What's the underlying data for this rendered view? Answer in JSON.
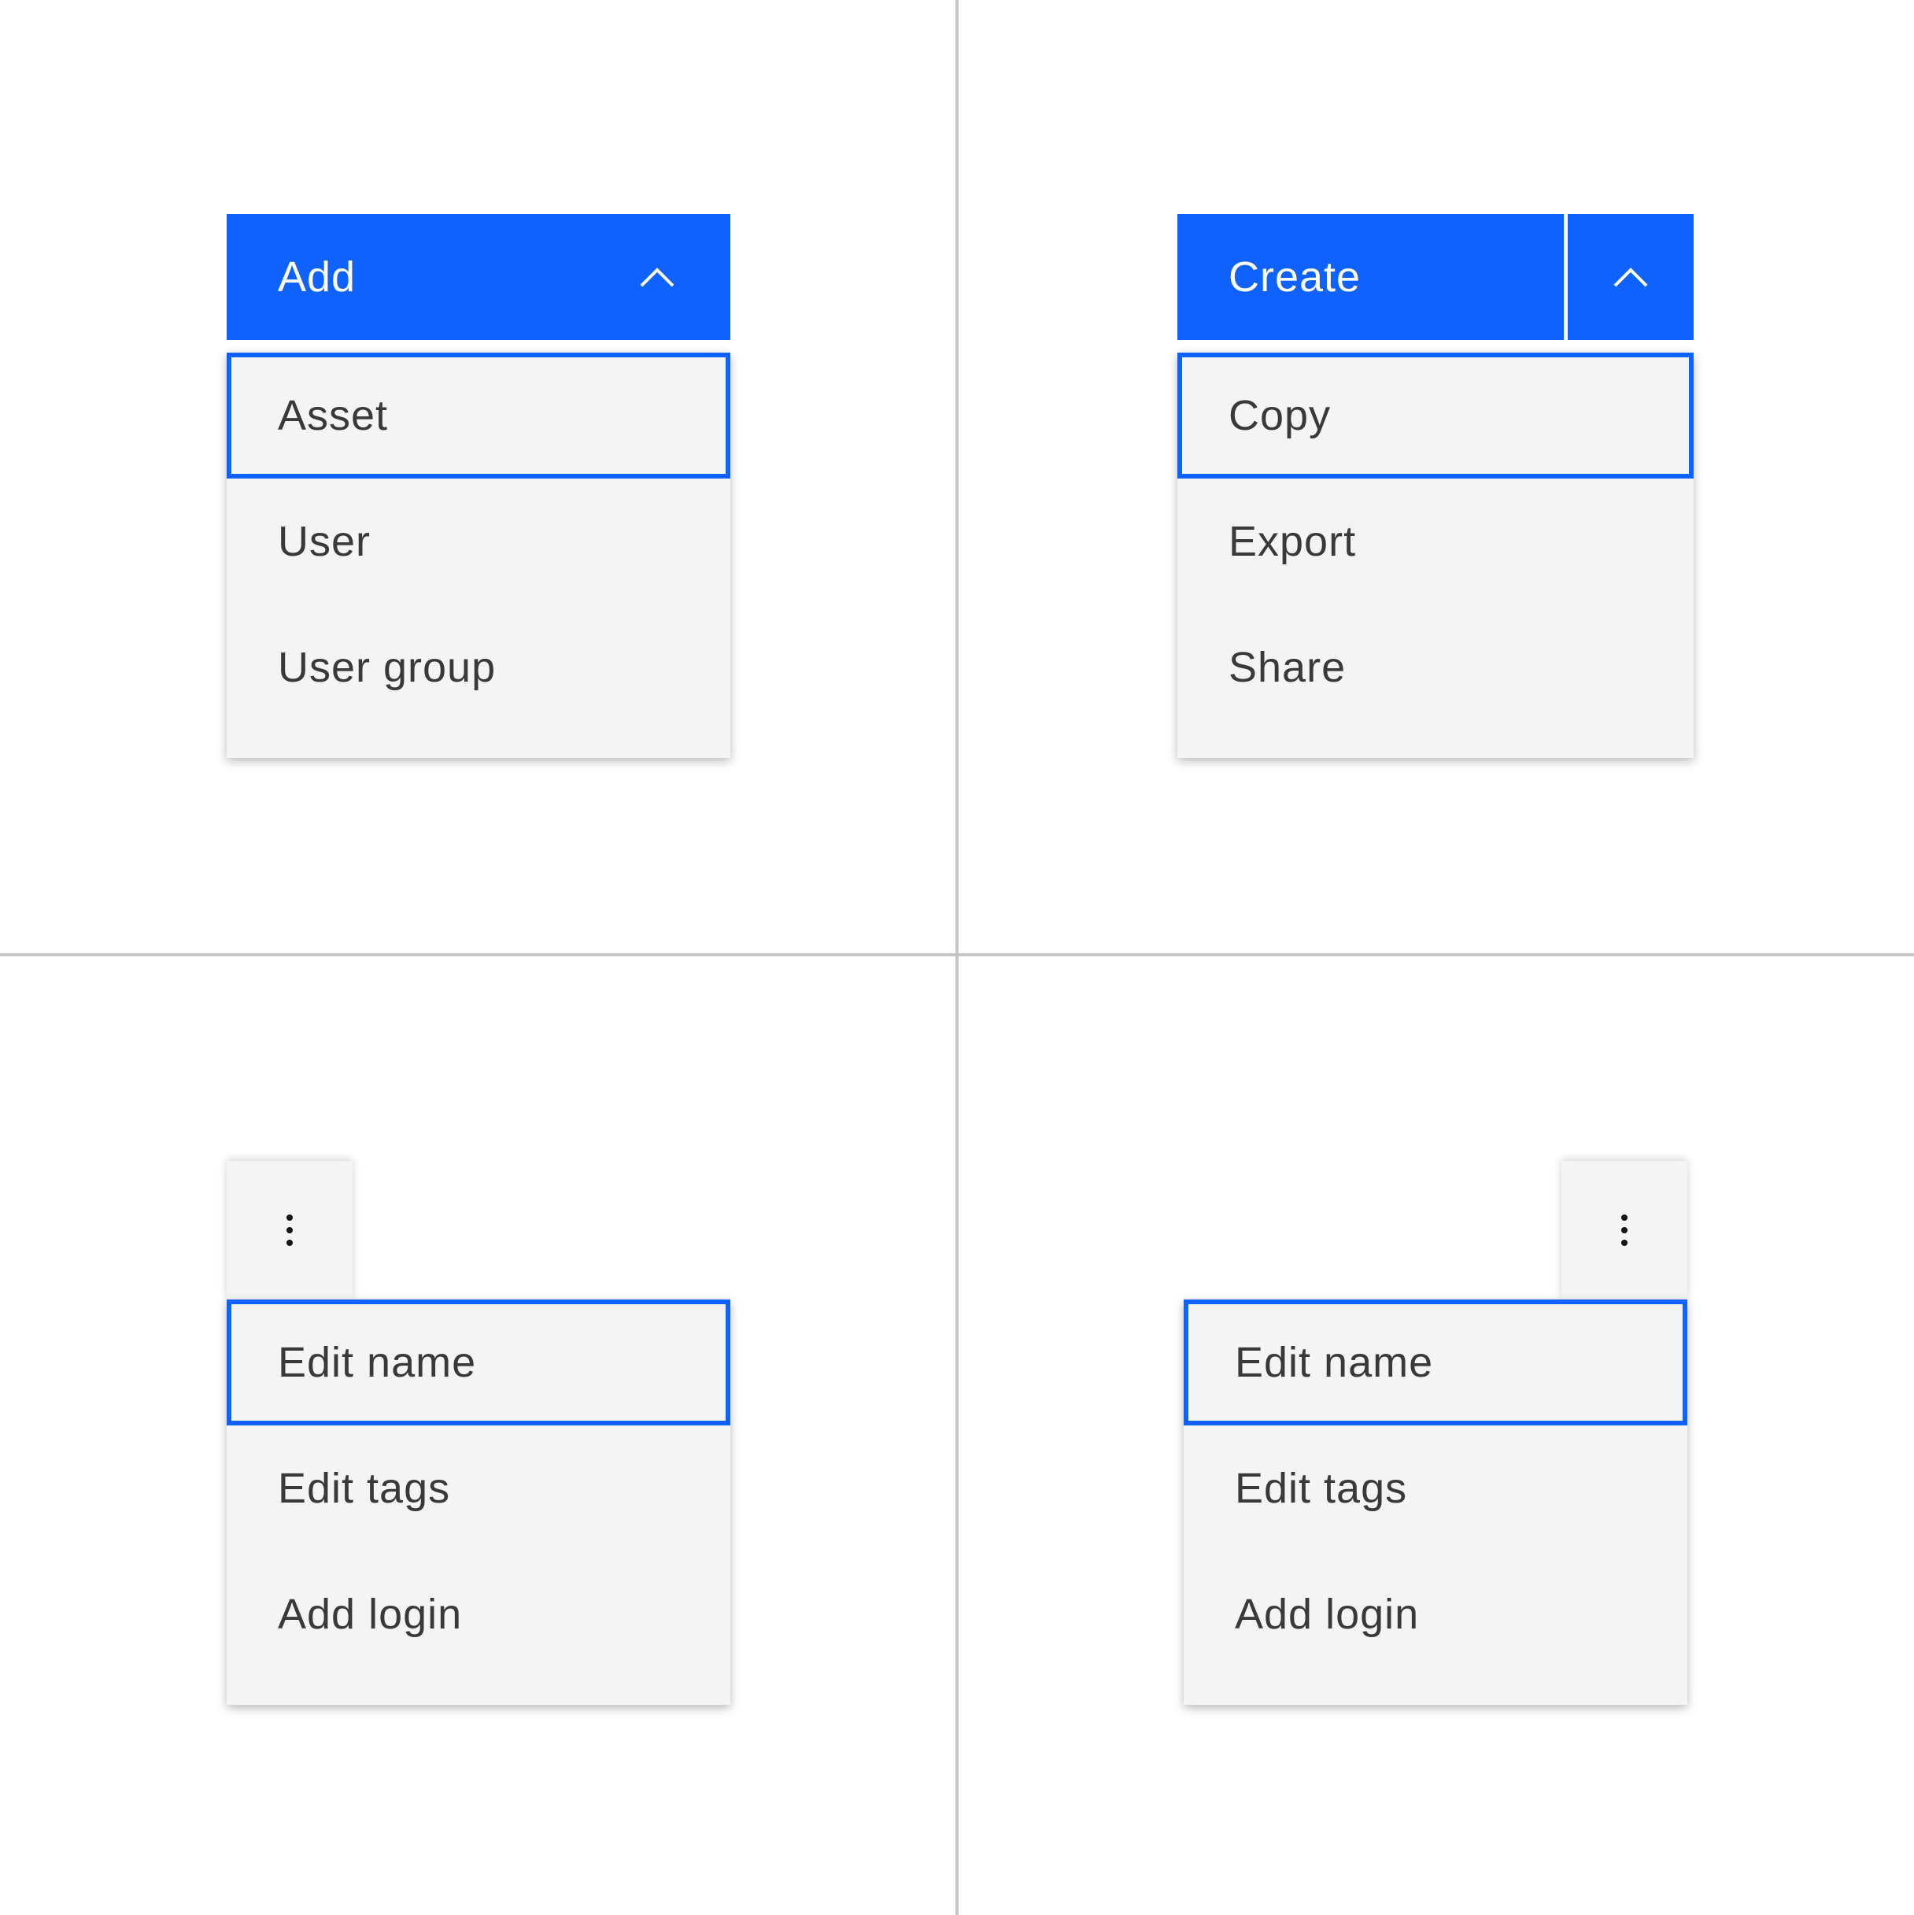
{
  "colors": {
    "primary": "#0f62fe",
    "menu_background": "#f4f4f4",
    "menu_text": "#393939",
    "divider": "#c6c6c6",
    "focus_outline": "#0f62fe"
  },
  "quadrants": {
    "top_left": {
      "trigger_label": "Add",
      "trigger_icon": "chevron-up-icon",
      "menu_items": [
        "Asset",
        "User",
        "User group"
      ],
      "focused_item": "Asset"
    },
    "top_right": {
      "trigger_label": "Create",
      "trigger_icon": "chevron-up-icon",
      "menu_items": [
        "Copy",
        "Export",
        "Share"
      ],
      "focused_item": "Copy"
    },
    "bottom_left": {
      "trigger_icon": "overflow-menu-vertical-icon",
      "menu_items": [
        "Edit name",
        "Edit tags",
        "Add login"
      ],
      "focused_item": "Edit name"
    },
    "bottom_right": {
      "trigger_icon": "overflow-menu-vertical-icon",
      "menu_items": [
        "Edit name",
        "Edit tags",
        "Add login"
      ],
      "focused_item": "Edit name"
    }
  }
}
